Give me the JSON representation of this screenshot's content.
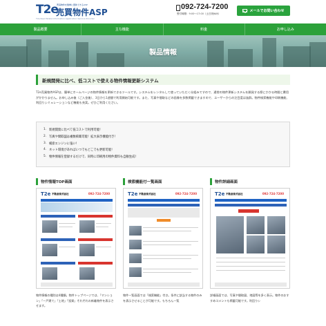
{
  "header": {
    "logo_mark": "T2e",
    "logo_name": "売買物件ASP",
    "logo_tagline": "売買物件を簡単に更新できるASP",
    "logo_sub": "T2e Real Estate Information Application Service Provider",
    "phone": "092-724-7200",
    "hours": "受付時間：9:00〜17:00（土日祝休み）",
    "mail_button": "メールでお問い合わせ"
  },
  "nav": {
    "items": [
      {
        "label": "製品概要"
      },
      {
        "label": "主な機能"
      },
      {
        "label": "料金"
      },
      {
        "label": "お申し込み"
      }
    ]
  },
  "hero": {
    "title": "製品情報"
  },
  "main": {
    "section_title": "新規開発に比べ、低コストで使える物件情報更新システム",
    "intro": "T2e売買物件ASPは、簡単にホームページの物件情報を更新できるツールです。システムをレンタルして使っていただく仕組みですので、通常の物件更新システムを開発する際にかかる時間と費用がかかりません。お申し込み後（ご入金後）、3日から1週間で利用開始可能です。また、写真や間取などの画像を多数掲載できますので、ユーザーからの注目度は抜群。物件検索機能や印刷機能、利回りシミュレーションなど機能も充実。ぜひご利用ください。",
    "features": [
      {
        "num": "1.",
        "text": "新規開発に比べて低コストで利用可能！"
      },
      {
        "num": "2.",
        "text": "写真や間取図は複数掲載可能！拡大表示機能付き！"
      },
      {
        "num": "3.",
        "text": "検索エンジンに強い！"
      },
      {
        "num": "4.",
        "text": "ネット環境があればいつでもどこでも更新可能！"
      },
      {
        "num": "5.",
        "text": "物件情報を登録するだけで、同時に印刷用の物件資料も自動生成！"
      }
    ]
  },
  "cards": [
    {
      "title": "物件情報TOP画面",
      "shot_logo": "T2e",
      "shot_company": "不動産株式会社",
      "shot_phone": "092-724-7200",
      "desc": "物件情報の種別は4種類。物件トップページでは、「マンション」「一戸建て」「土地」「投資」それぞれの新着物件を表示させます。"
    },
    {
      "title": "検索機能付一覧画面",
      "shot_logo": "T2e",
      "shot_company": "不動産株式会社",
      "shot_phone": "092-724-7200",
      "desc": "物件一覧画面では「検索機能」付き。条件に該当する物件のみを表示させることが可能です。もちろん一覧"
    },
    {
      "title": "物件詳細画面",
      "shot_logo": "T2e",
      "shot_company": "不動産株式会社",
      "shot_phone": "092-724-7200",
      "desc": "詳細画面では、写真や間取図、地図等を多く表示。物件のおすすめコメントも掲載可能です。利回りシ"
    }
  ]
}
